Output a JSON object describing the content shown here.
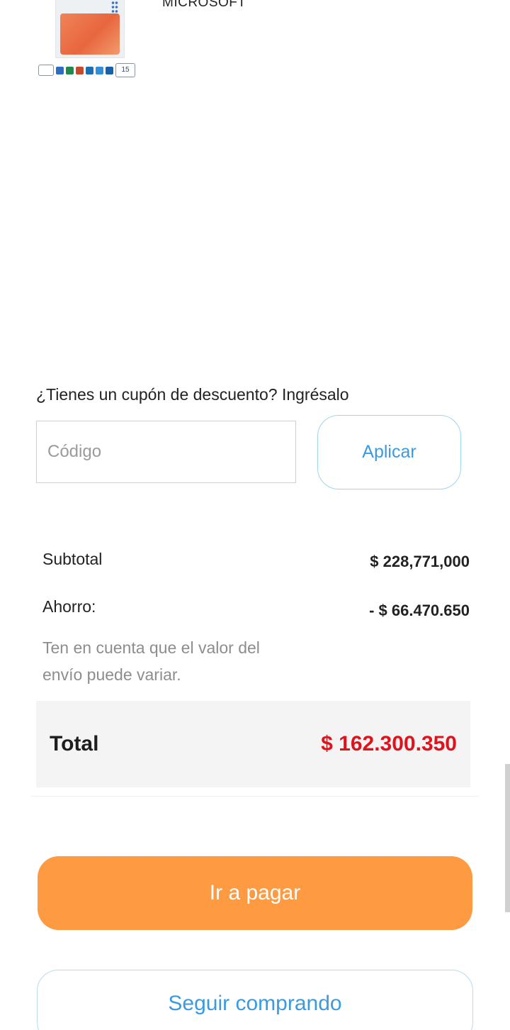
{
  "product": {
    "brand": "MICROSOFT",
    "box_badge": "15"
  },
  "coupon": {
    "prompt": "¿Tienes un cupón de descuento? Ingrésalo",
    "placeholder": "Código",
    "value": "",
    "apply_label": "Aplicar"
  },
  "summary": {
    "subtotal_label": "Subtotal",
    "subtotal_value": "$ 228,771,000",
    "savings_label": "Ahorro:",
    "savings_value": "- $ 66.470.650",
    "shipping_note": "Ten en cuenta que el valor del envío puede variar.",
    "total_label": "Total",
    "total_value": "$ 162.300.350"
  },
  "actions": {
    "pay_label": "Ir a pagar",
    "continue_label": "Seguir comprando"
  },
  "colors": {
    "accent_orange": "#fd9a42",
    "link_blue": "#3b9ae0",
    "total_red": "#e0121b",
    "total_bg": "#f4f4f4"
  }
}
